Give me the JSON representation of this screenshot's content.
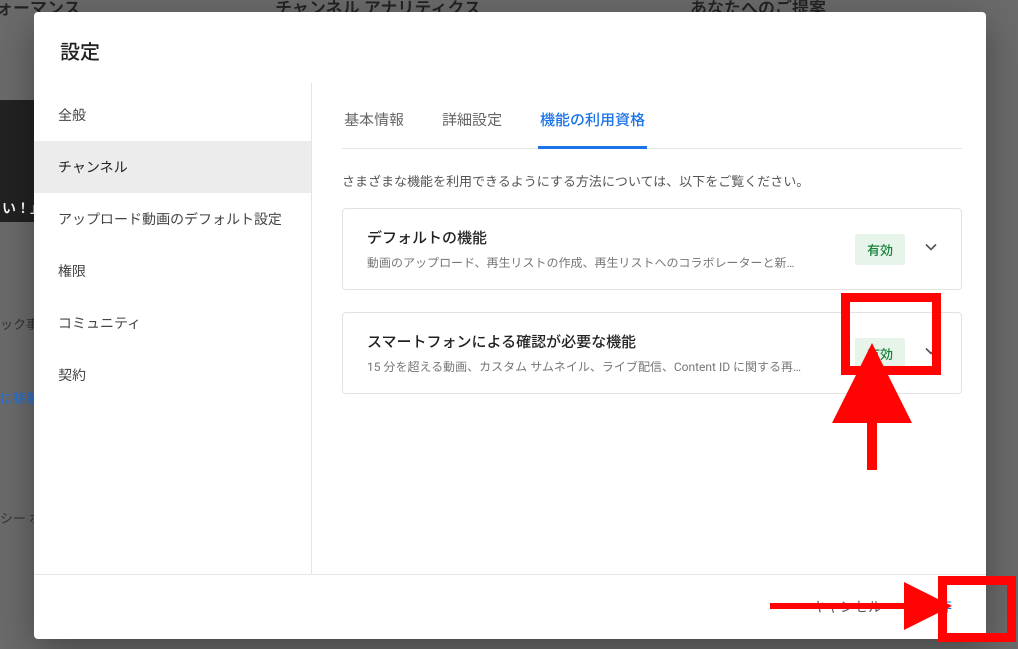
{
  "background": {
    "header1": "ォーマンス",
    "header2": "チャンネル アナリティクス",
    "header3": "あなたへのご提案",
    "band": "い！」",
    "side_text1": "ック事",
    "side_link": "に移動",
    "side_text2": "シー ポ"
  },
  "modal": {
    "title": "設定"
  },
  "sidebar": {
    "items": [
      {
        "label": "全般"
      },
      {
        "label": "チャンネル"
      },
      {
        "label": "アップロード動画のデフォルト設定"
      },
      {
        "label": "権限"
      },
      {
        "label": "コミュニティ"
      },
      {
        "label": "契約"
      }
    ]
  },
  "tabs": [
    {
      "label": "基本情報"
    },
    {
      "label": "詳細設定"
    },
    {
      "label": "機能の利用資格"
    }
  ],
  "intro": "さまざまな機能を利用できるようにする方法については、以下をご覧ください。",
  "cards": [
    {
      "title": "デフォルトの機能",
      "sub": "動画のアップロード、再生リストの作成、再生リストへのコラボレーターと新…",
      "badge": "有効"
    },
    {
      "title": "スマートフォンによる確認が必要な機能",
      "sub": "15 分を超える動画、カスタム サムネイル、ライブ配信、Content ID に関する再…",
      "badge": "有効"
    }
  ],
  "footer": {
    "cancel": "キャンセル",
    "save": "保存"
  }
}
